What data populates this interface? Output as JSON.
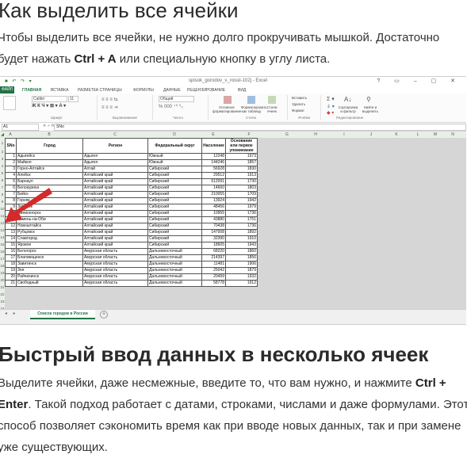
{
  "section1": {
    "heading": "Как выделить все ячейки",
    "p_part1": "Чтобы выделить все ячейки, не нужно долго прокручивать мышкой. Достаточно будет нажать ",
    "p_bold": "Ctrl + A",
    "p_part2": " или специальную кнопку в углу листа."
  },
  "excel": {
    "window_title": "spisok_gorodov_v_rossii-102j - Excel",
    "ribbon_tabs": [
      "ФАЙЛ",
      "ГЛАВНАЯ",
      "ВСТАВКА",
      "РАЗМЕТКА СТРАНИЦЫ",
      "ФОРМУЛЫ",
      "ДАННЫЕ",
      "РЕЦЕНЗИРОВАНИЕ",
      "ВИД"
    ],
    "font_name": "Calibri",
    "font_size": "11",
    "number_format": "Общий",
    "group_labels": [
      "Шрифт",
      "Выравнивание",
      "Число",
      "Стили",
      "Ячейки",
      "Редактирование"
    ],
    "ribbon_buttons": [
      "Условное форматирование",
      "Форматировать как таблицу",
      "Стили ячеек",
      "Вставить",
      "Удалить",
      "Формат",
      "Сортировка и фильтр",
      "Найти и выделить"
    ],
    "name_box": "A1",
    "formula_value": "SNo",
    "columns": [
      "A",
      "B",
      "C",
      "D",
      "E",
      "F",
      "G",
      "H",
      "I",
      "J",
      "K",
      "L",
      "M",
      "N"
    ],
    "table_headers": [
      "SNo",
      "Город",
      "Регион",
      "Федеральный округ",
      "Население",
      "Основание или первое упоминание"
    ],
    "rows": [
      [
        "1",
        "Адыгейск",
        "Адыгея",
        "Южный",
        "12248",
        "1973"
      ],
      [
        "2",
        "Майкоп",
        "Адыгея",
        "Южный",
        "144246",
        "1857"
      ],
      [
        "3",
        "Горно-Алтайск",
        "Алтай",
        "Сибирский",
        "56928",
        "1830"
      ],
      [
        "4",
        "Алейск",
        "Алтайский край",
        "Сибирский",
        "29512",
        "1913"
      ],
      [
        "5",
        "Барнаул",
        "Алтайский край",
        "Сибирский",
        "612091",
        "1730"
      ],
      [
        "6",
        "Белокуриха",
        "Алтайский край",
        "Сибирский",
        "14660",
        "1803"
      ],
      [
        "7",
        "Бийск",
        "Алтайский край",
        "Сибирский",
        "210055",
        "1709"
      ],
      [
        "8",
        "Горняк",
        "Алтайский край",
        "Сибирский",
        "13924",
        "1942"
      ],
      [
        "9",
        "Заринск",
        "Алтайский край",
        "Сибирский",
        "48456",
        "1979"
      ],
      [
        "10",
        "Змеиногорск",
        "Алтайский край",
        "Сибирский",
        "10955",
        "1736"
      ],
      [
        "11",
        "Камень-на-Оби",
        "Алтайский край",
        "Сибирский",
        "43880",
        "1751"
      ],
      [
        "12",
        "Новоалтайск",
        "Алтайский край",
        "Сибирский",
        "70438",
        "1736"
      ],
      [
        "13",
        "Рубцовск",
        "Алтайский край",
        "Сибирский",
        "147008",
        "1892"
      ],
      [
        "14",
        "Славгород",
        "Алтайский край",
        "Сибирский",
        "32390",
        "1910"
      ],
      [
        "15",
        "Яровое",
        "Алтайский край",
        "Сибирский",
        "18605",
        "1943"
      ],
      [
        "16",
        "Белогорск",
        "Амурская область",
        "Дальневосточный",
        "68220",
        "1860"
      ],
      [
        "17",
        "Благовещенск",
        "Амурская область",
        "Дальневосточный",
        "214397",
        "1856"
      ],
      [
        "18",
        "Завитинск",
        "Амурская область",
        "Дальневосточный",
        "11481",
        "1906"
      ],
      [
        "19",
        "Зея",
        "Амурская область",
        "Дальневосточный",
        "25042",
        "1879"
      ],
      [
        "20",
        "Райчихинск",
        "Амурская область",
        "Дальневосточный",
        "20499",
        "1932"
      ],
      [
        "21",
        "Свободный",
        "Амурская область",
        "Дальневосточный",
        "58778",
        "1912"
      ]
    ],
    "sheet_tab": "Список городов в России"
  },
  "section2": {
    "heading": "Быстрый ввод данных в несколько ячеек",
    "p_part1": "Выделите ячейки, даже несмежные, введите то, что вам нужно, и нажмите ",
    "p_bold": "Ctrl + Enter",
    "p_part2": ". Такой подход работает с датами, строками, числами и даже формулами. Этот способ позволяет сэкономить время как при вводе новых данных, так и при замене уже существующих."
  },
  "colors": {
    "excel_green": "#217346",
    "arrow_red": "#d42a2a"
  }
}
